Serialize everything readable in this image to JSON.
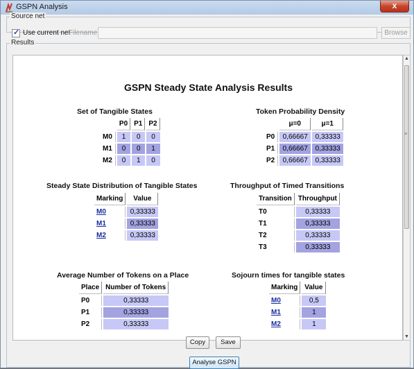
{
  "window": {
    "title": "GSPN Analysis",
    "close_glyph": "x"
  },
  "source_net": {
    "group_label": "Source net",
    "use_current_net_label": "Use current net",
    "use_current_net_checked": true,
    "filename_label": "Filename:",
    "filename_value": "",
    "browse_label": "Browse"
  },
  "results": {
    "group_label": "Results",
    "title": "GSPN Steady State Analysis Results",
    "tangible_states": {
      "title": "Set of Tangible States",
      "columns": [
        "P0",
        "P1",
        "P2"
      ],
      "rows": [
        {
          "label": "M0",
          "values": [
            "1",
            "0",
            "0"
          ]
        },
        {
          "label": "M1",
          "values": [
            "0",
            "0",
            "1"
          ]
        },
        {
          "label": "M2",
          "values": [
            "0",
            "1",
            "0"
          ]
        }
      ]
    },
    "token_density": {
      "title": "Token Probability Density",
      "columns": [
        "μ=0",
        "μ=1"
      ],
      "rows": [
        {
          "label": "P0",
          "values": [
            "0,66667",
            "0,33333"
          ]
        },
        {
          "label": "P1",
          "values": [
            "0,66667",
            "0,33333"
          ]
        },
        {
          "label": "P2",
          "values": [
            "0,66667",
            "0,33333"
          ]
        }
      ]
    },
    "steady_state": {
      "title": "Steady State Distribution of Tangible States",
      "columns": [
        "Marking",
        "Value"
      ],
      "rows": [
        {
          "label": "M0",
          "value": "0,33333"
        },
        {
          "label": "M1",
          "value": "0,33333"
        },
        {
          "label": "M2",
          "value": "0,33333"
        }
      ]
    },
    "throughput": {
      "title": "Throughput of Timed Transitions",
      "columns": [
        "Transition",
        "Throughput"
      ],
      "rows": [
        {
          "label": "T0",
          "value": "0,33333"
        },
        {
          "label": "T1",
          "value": "0,33333"
        },
        {
          "label": "T2",
          "value": "0,33333"
        },
        {
          "label": "T3",
          "value": "0,33333"
        }
      ]
    },
    "avg_tokens": {
      "title": "Average Number of Tokens on a Place",
      "columns": [
        "Place",
        "Number of Tokens"
      ],
      "rows": [
        {
          "label": "P0",
          "value": "0,33333"
        },
        {
          "label": "P1",
          "value": "0,33333"
        },
        {
          "label": "P2",
          "value": "0,33333"
        }
      ]
    },
    "sojourn": {
      "title": "Sojourn times for tangible states",
      "columns": [
        "Marking",
        "Value"
      ],
      "rows": [
        {
          "label": "M0",
          "value": "0,5"
        },
        {
          "label": "M1",
          "value": "1"
        },
        {
          "label": "M2",
          "value": "1"
        }
      ]
    }
  },
  "buttons": {
    "copy": "Copy",
    "save": "Save",
    "analyse": "Analyse GSPN"
  },
  "colors": {
    "cell_light": "#c8c8f6",
    "cell_dark": "#a3a3e2",
    "link": "#1a2d9e"
  }
}
